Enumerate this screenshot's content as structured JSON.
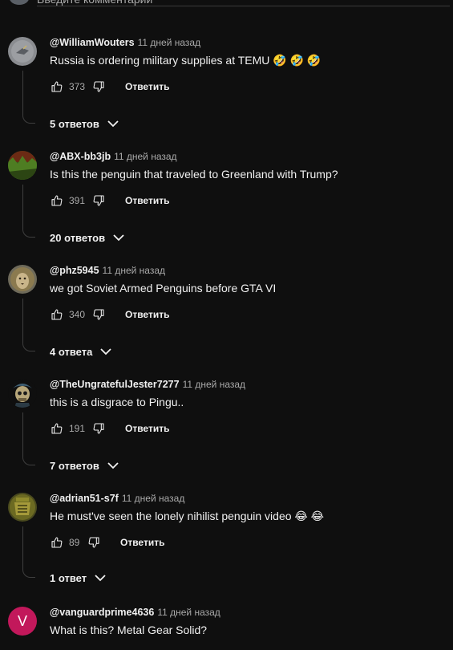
{
  "composer": {
    "placeholder": "Введите комментарий"
  },
  "labels": {
    "reply": "Ответить"
  },
  "comments": [
    {
      "author": "@WilliamWouters",
      "time": "11 дней назад",
      "text": "Russia is ordering military supplies at TEMU 🤣 🤣 🤣",
      "likes": "373",
      "replies": "5 ответов",
      "avatar": "grey-bird-avatar"
    },
    {
      "author": "@ABX-bb3jb",
      "time": "11 дней назад",
      "text": "Is this the penguin that traveled to Greenland with Trump?",
      "likes": "391",
      "replies": "20 ответов",
      "avatar": "forest-avatar"
    },
    {
      "author": "@phz5945",
      "time": "11 дней назад",
      "text": "we got Soviet Armed Penguins before GTA VI",
      "likes": "340",
      "replies": "4 ответа",
      "avatar": "lion-avatar"
    },
    {
      "author": "@TheUngratefulJester7277",
      "time": "11 дней назад",
      "text": "this is a disgrace to Pingu..",
      "likes": "191",
      "replies": "7 ответов",
      "avatar": "skull-avatar"
    },
    {
      "author": "@adrian51-s7f",
      "time": "11 дней назад",
      "text": "He must've seen the lonely nihilist penguin video 😂 😂",
      "likes": "89",
      "replies": "1 ответ",
      "avatar": "badge-avatar"
    },
    {
      "author": "@vanguardprime4636",
      "time": "11 дней назад",
      "text": "What is this? Metal Gear Solid?",
      "avatar_letter": "V",
      "avatar_color": "#c2185b"
    }
  ]
}
